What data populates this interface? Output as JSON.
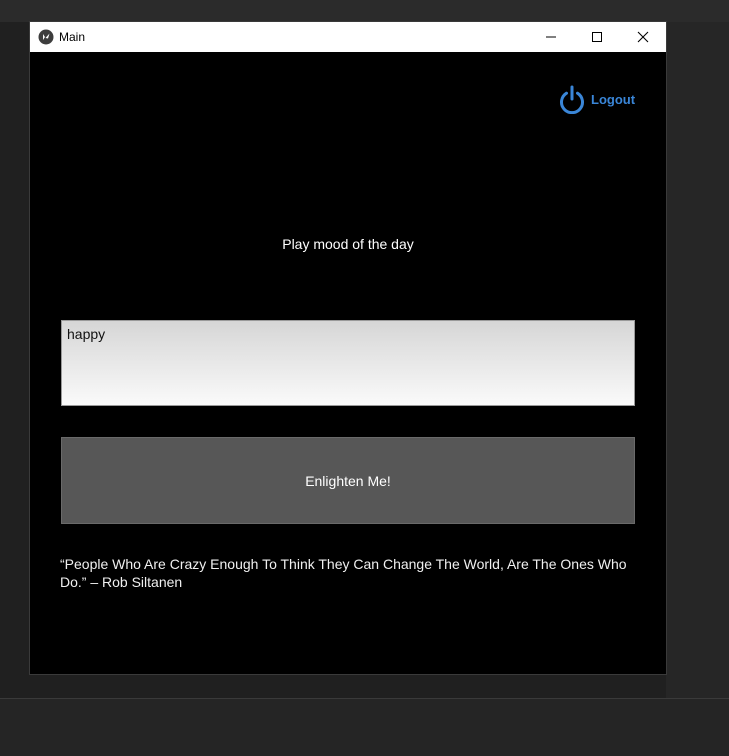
{
  "window": {
    "title": "Main",
    "icon": "kivy-logo-icon",
    "controls": [
      "minimize-icon",
      "maximize-icon",
      "close-icon"
    ]
  },
  "header": {
    "logout_label": "Logout",
    "logout_icon": "power-icon"
  },
  "main": {
    "mood_label": "Play mood of the day",
    "mood_input_value": "happy",
    "enlighten_button_label": "Enlighten Me!",
    "quote": "“People Who Are Crazy Enough To Think They Can Change The World, Are The Ones Who Do.” – Rob Siltanen"
  },
  "colors": {
    "accent": "#3a86d8",
    "background": "#000000",
    "button": "#575757"
  }
}
